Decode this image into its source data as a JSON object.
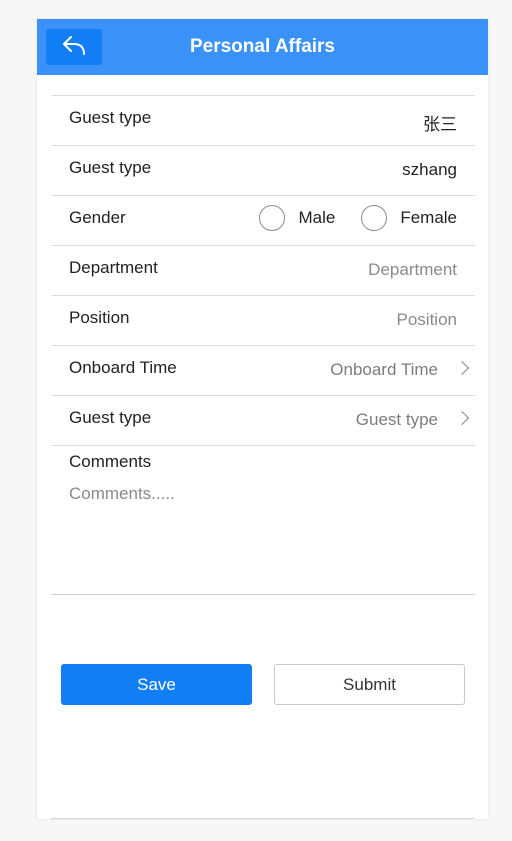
{
  "header": {
    "title": "Personal Affairs",
    "back_icon": "reply-arrow-icon",
    "background_color": "#3a92f9",
    "back_button_color": "#127ef6"
  },
  "form": {
    "rows": [
      {
        "label": "Guest type",
        "value": "张三"
      },
      {
        "label": "Guest type",
        "value": "szhang"
      }
    ],
    "gender": {
      "label": "Gender",
      "options": [
        "Male",
        "Female"
      ]
    },
    "department": {
      "label": "Department",
      "placeholder": "Department"
    },
    "position": {
      "label": "Position",
      "placeholder": "Position"
    },
    "onboard_time": {
      "label": "Onboard Time",
      "value": "Onboard Time"
    },
    "guest_type_picker": {
      "label": "Guest type",
      "value": "Guest type"
    },
    "comments": {
      "label": "Comments",
      "placeholder": "Comments....."
    }
  },
  "actions": {
    "save_label": "Save",
    "submit_label": "Submit",
    "accent_color": "#127ef6"
  }
}
